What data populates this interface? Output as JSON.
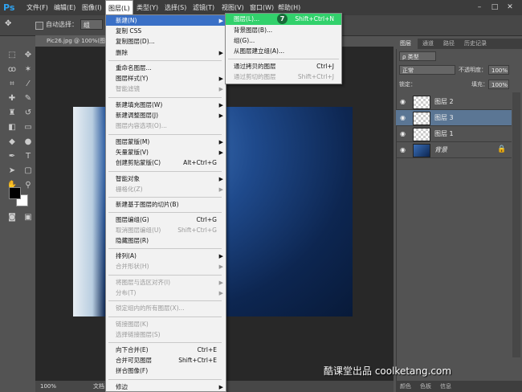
{
  "app": {
    "logo": "Ps"
  },
  "menubar": {
    "items": [
      "文件(F)",
      "编辑(E)",
      "图像(I)",
      "图层(L)",
      "类型(Y)",
      "选择(S)",
      "滤镜(T)",
      "视图(V)",
      "窗口(W)",
      "帮助(H)"
    ],
    "active": "图层(L)"
  },
  "options_bar": {
    "auto_select_label": "自动选择：",
    "auto_select_value": "组"
  },
  "document": {
    "tab_title": "Pic26.jpg @ 100%(图",
    "zoom": "100%",
    "status_text": "文档"
  },
  "layer_menu": {
    "items": [
      {
        "label": "新建(N)",
        "submenu": true,
        "highlighted": true
      },
      {
        "label": "复制 CSS"
      },
      {
        "label": "复制图层(D)..."
      },
      {
        "label": "删除",
        "submenu": true
      },
      {
        "label": "重命名图层..."
      },
      {
        "label": "图层样式(Y)",
        "submenu": true
      },
      {
        "label": "智能滤镜",
        "submenu": true,
        "disabled": true
      },
      {
        "label": "新建填充图层(W)",
        "submenu": true
      },
      {
        "label": "新建调整图层(J)",
        "submenu": true
      },
      {
        "label": "图层内容选项(O)...",
        "disabled": true
      },
      {
        "label": "图层蒙版(M)",
        "submenu": true
      },
      {
        "label": "矢量蒙版(V)",
        "submenu": true
      },
      {
        "label": "创建剪贴蒙版(C)",
        "shortcut": "Alt+Ctrl+G"
      },
      {
        "label": "智能对象",
        "submenu": true
      },
      {
        "label": "栅格化(Z)",
        "submenu": true,
        "disabled": true
      },
      {
        "label": "新建基于图层的切片(B)"
      },
      {
        "label": "图层编组(G)",
        "shortcut": "Ctrl+G"
      },
      {
        "label": "取消图层编组(U)",
        "shortcut": "Shift+Ctrl+G",
        "disabled": true
      },
      {
        "label": "隐藏图层(R)"
      },
      {
        "label": "排列(A)",
        "submenu": true
      },
      {
        "label": "合并形状(H)",
        "submenu": true,
        "disabled": true
      },
      {
        "label": "将图层与选区对齐(I)",
        "submenu": true,
        "disabled": true
      },
      {
        "label": "分布(T)",
        "submenu": true,
        "disabled": true
      },
      {
        "label": "锁定组内的所有图层(X)...",
        "disabled": true
      },
      {
        "label": "链接图层(K)",
        "disabled": true
      },
      {
        "label": "选择链接图层(S)",
        "disabled": true
      },
      {
        "label": "向下合并(E)",
        "shortcut": "Ctrl+E"
      },
      {
        "label": "合并可见图层",
        "shortcut": "Shift+Ctrl+E"
      },
      {
        "label": "拼合图像(F)"
      },
      {
        "label": "修边",
        "submenu": true
      }
    ]
  },
  "new_submenu": {
    "items": [
      {
        "label": "图层(L)...",
        "shortcut": "Shift+Ctrl+N",
        "highlighted": true
      },
      {
        "label": "背景图层(B)..."
      },
      {
        "label": "组(G)..."
      },
      {
        "label": "从图层建立组(A)..."
      },
      {
        "label": "通过拷贝的图层",
        "shortcut": "Ctrl+J"
      },
      {
        "label": "通过剪切的图层",
        "shortcut": "Shift+Ctrl+J",
        "disabled": true
      }
    ],
    "step_badge": "7"
  },
  "layers_panel": {
    "tabs": [
      "图层",
      "通道",
      "路径",
      "历史记录"
    ],
    "filter_label": "ρ 类型",
    "blend_mode": "正常",
    "opacity_label": "不透明度：",
    "opacity_value": "100%",
    "lock_label": "锁定：",
    "fill_label": "填充：",
    "fill_value": "100%",
    "layers": [
      {
        "name": "图层 2",
        "selected": false
      },
      {
        "name": "图层 3",
        "selected": true
      },
      {
        "name": "图层 1",
        "selected": false
      },
      {
        "name": "背景",
        "selected": false,
        "locked": true
      }
    ],
    "bottom_tabs": [
      "颜色",
      "色板",
      "信息"
    ]
  },
  "watermark": "酷课堂出品 coolketang.com",
  "colors": {
    "highlight_blue": "#3a70c6",
    "highlight_green": "#32d16c",
    "selected_layer": "#5b7694"
  }
}
